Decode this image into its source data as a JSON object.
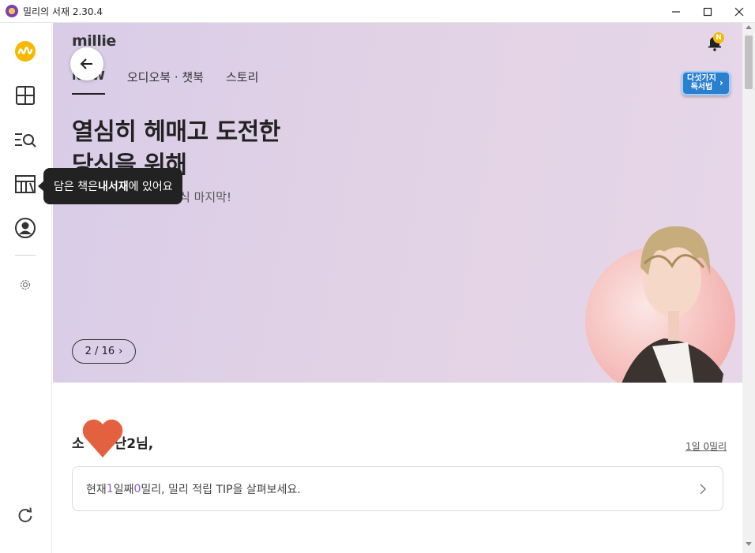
{
  "window": {
    "title": "밀리의 서재 2.30.4"
  },
  "sidebar": {
    "items": [
      {
        "name": "millie-logo-icon"
      },
      {
        "name": "add-grid-icon"
      },
      {
        "name": "search-list-icon"
      },
      {
        "name": "bookshelf-icon"
      },
      {
        "name": "profile-icon"
      },
      {
        "name": "settings-gear-icon"
      },
      {
        "name": "refresh-icon"
      }
    ]
  },
  "tooltip": {
    "prefix": "담은 책은 ",
    "bold": "내서재",
    "suffix": "에 있어요"
  },
  "banner": {
    "logo": "millie",
    "tabs": [
      {
        "label": "NOW",
        "active": true
      },
      {
        "label": "오디오북 · 챗북",
        "active": false
      },
      {
        "label": "스토리",
        "active": false
      }
    ],
    "notification_badge": "N",
    "reading_badge_line1": "다섯가지",
    "reading_badge_line2": "독서법",
    "headline_line1": "열심히 헤매고 도전한",
    "headline_line2": "당신을 위해",
    "subline": "식 마지막!",
    "counter": "2 / 16",
    "background_color": "#e1d3e6"
  },
  "greeting": {
    "left": "소",
    "right": "난2님,"
  },
  "usage_link": "1일 0밀리",
  "tip": {
    "part1": "현재 ",
    "day_value": "1",
    "part2": "일째 ",
    "milli_value": "0",
    "part3": "밀리, 밀리 적립 TIP을 살펴보세요."
  },
  "colors": {
    "accent": "#8b5ad8",
    "brand_yellow": "#f6b800",
    "heart": "#e3613f"
  }
}
